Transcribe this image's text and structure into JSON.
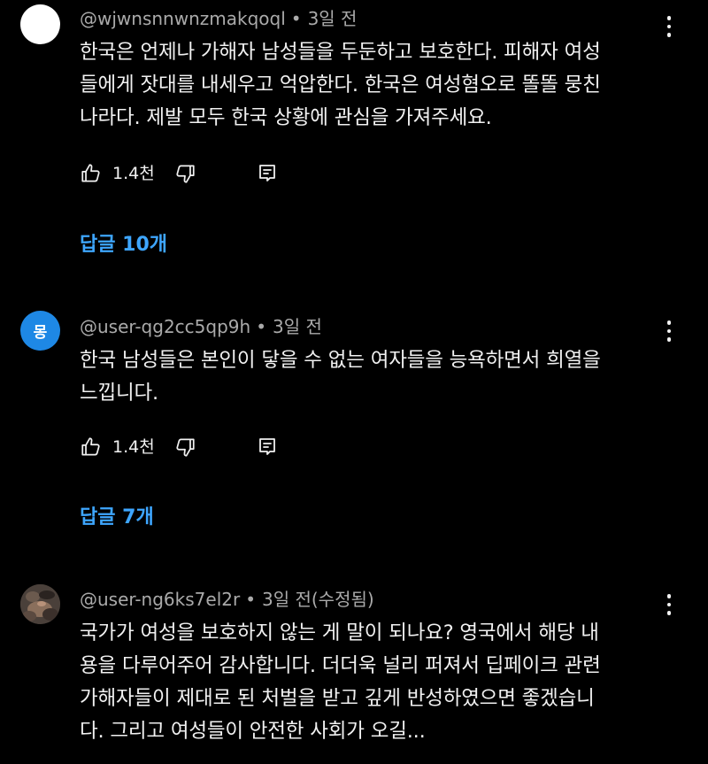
{
  "comments": [
    {
      "author": "@wjwnsnnwnzmakqoql",
      "time": "3일 전",
      "text": "한국은 언제나 가해자 남성들을 두둔하고 보호한다. 피해자 여성\n들에게 잣대를 내세우고 억압한다. 한국은 여성혐오로 똘똘 뭉친\n나라다. 제발 모두 한국 상황에 관심을 가져주세요.",
      "likes": "1.4천",
      "replies": "답글 10개"
    },
    {
      "author": "@user-qg2cc5qp9h",
      "time": "3일 전",
      "avatar_letter": "몽",
      "text": "한국 남성들은 본인이 닿을 수 없는 여자들을 능욕하면서 희열을\n느낍니다.",
      "likes": "1.4천",
      "replies": "답글 7개"
    },
    {
      "author": "@user-ng6ks7el2r",
      "time": "3일 전(수정됨)",
      "text": "국가가 여성을 보호하지 않는 게 말이 되나요? 영국에서 해당 내\n용을 다루어주어 감사합니다. 더더욱 널리 퍼져서 딥페이크 관련\n가해자들이 제대로 된 처벌을 받고 깊게 반성하였으면 좋겠습니\n다. 그리고 여성들이 안전한 사회가 오길..."
    }
  ],
  "ui": {
    "separator": "•"
  },
  "icons": {
    "like": "thumb-up-icon",
    "dislike": "thumb-down-icon",
    "reply": "comment-reply-icon",
    "more": "more-vertical-icon"
  },
  "colors": {
    "background": "#000000",
    "text": "#f1f1f1",
    "meta": "#aaaaaa",
    "link": "#3ea6ff",
    "avatar_blue": "#1e88e5"
  }
}
